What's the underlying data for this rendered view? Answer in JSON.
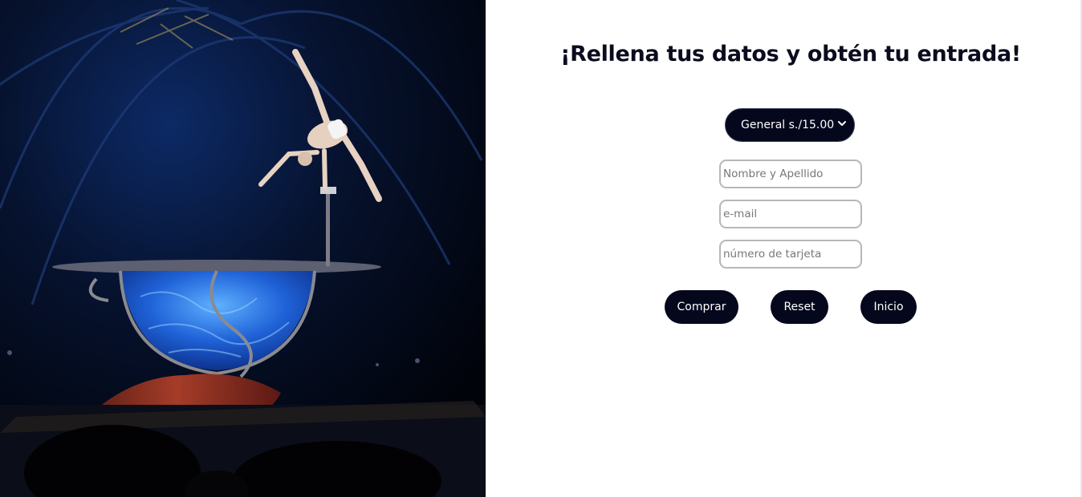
{
  "hero": {
    "image_icon": "acrobat-over-water-bowl-photo"
  },
  "form": {
    "title": "¡Rellena tus datos y obtén tu entrada!",
    "ticket_select": {
      "selected": "General s./15.00",
      "options": [
        "General s./15.00"
      ]
    },
    "fields": {
      "name_placeholder": "Nombre y Apellido",
      "email_placeholder": "e-mail",
      "card_placeholder": "número de tarjeta"
    },
    "buttons": {
      "buy": "Comprar",
      "reset": "Reset",
      "home": "Inicio"
    }
  },
  "colors": {
    "button_bg": "#05081d",
    "title_text": "#0a0c1e",
    "field_border": "#b7b7b7"
  }
}
